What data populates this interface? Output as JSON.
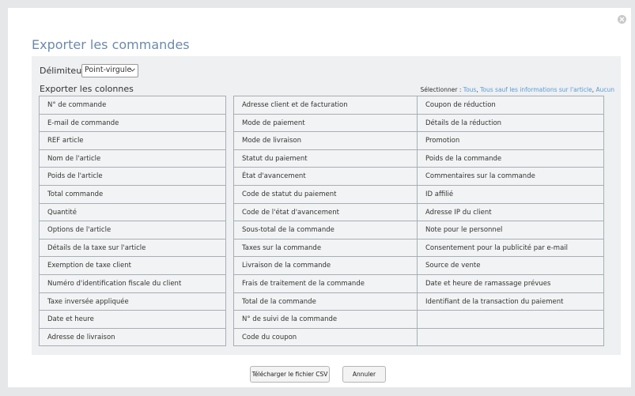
{
  "dialog": {
    "title": "Exporter les commandes",
    "delimiter_label": "Délimiteur",
    "delimiter_value": "Point-virgule",
    "export_columns_label": "Exporter les colonnes",
    "select_label": "Sélectionner :",
    "select_links": [
      "Tous",
      "Tous sauf les informations sur l'article",
      "Aucun"
    ],
    "columns": [
      [
        "N° de commande",
        "E-mail de commande",
        "REF article",
        "Nom de l'article",
        "Poids de l'article",
        "Total commande",
        "Quantité",
        "Options de l'article",
        "Détails de la taxe sur l'article",
        "Exemption de taxe client",
        "Numéro d'identification fiscale du client",
        "Taxe inversée appliquée",
        "Date et heure",
        "Adresse de livraison"
      ],
      [
        "Adresse client et de facturation",
        "Mode de paiement",
        "Mode de livraison",
        "Statut du paiement",
        "État d'avancement",
        "Code de statut du paiement",
        "Code de l'état d'avancement",
        "Sous-total de la commande",
        "Taxes sur la commande",
        "Livraison de la commande",
        "Frais de traitement de la commande",
        "Total de la commande",
        "N° de suivi de la commande",
        "Code du coupon"
      ],
      [
        "Coupon de réduction",
        "Détails de la réduction",
        "Promotion",
        "Poids de la commande",
        "Commentaires sur la commande",
        "ID affilié",
        "Adresse IP du client",
        "Note pour le personnel",
        "Consentement pour la publicité par e-mail",
        "Source de vente",
        "Date et heure de ramassage prévues",
        "Identifiant de la transaction du paiement",
        "",
        ""
      ]
    ],
    "download_button": "Télécharger le fichier CSV",
    "cancel_button": "Annuler",
    "icons": {
      "close": "close-icon",
      "dropdown": "chevron-down-icon"
    }
  }
}
